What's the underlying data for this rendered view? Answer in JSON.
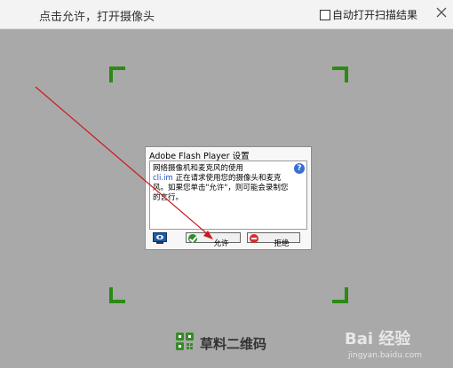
{
  "header": {
    "title": "点击允许，打开摄像头",
    "auto_open_label": "自动打开扫描结果",
    "auto_open_checked": false,
    "close_icon": "close-icon"
  },
  "flash_dialog": {
    "title": "Adobe Flash Player 设置",
    "line1": "网络摄像机和麦克风的使用",
    "domain": "cli.im",
    "line2": " 正在请求使用您的摄像头和麦克风。如果您单击\"允许\"，则可能会录制您的言行。",
    "allow_label": "允许",
    "deny_label": "拒绝",
    "help_icon": "?"
  },
  "brand": {
    "label": "草料二维码",
    "icon": "qr-logo-icon"
  },
  "watermark": {
    "text": "Bai 经验",
    "url": "jingyan.baidu.com"
  },
  "colors": {
    "background": "#a9a9a9",
    "scan_corner": "#2c8a15",
    "annotation_arrow": "#cc1a1a"
  }
}
